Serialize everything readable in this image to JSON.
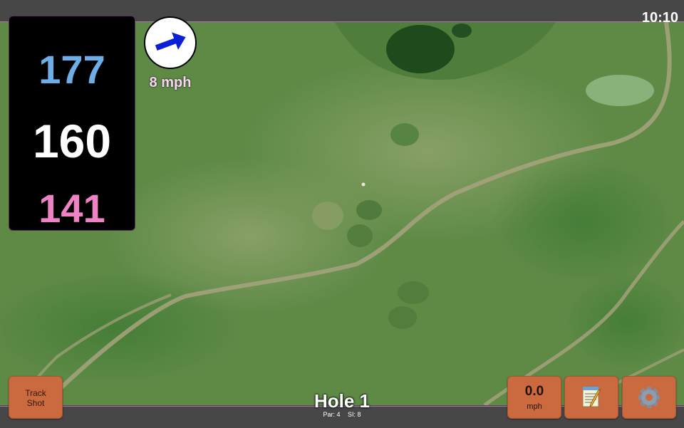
{
  "status_bar": {
    "time": "10:10"
  },
  "distances": {
    "back": "177",
    "middle": "160",
    "front": "141"
  },
  "wind": {
    "speed_label": "8 mph",
    "direction_icon": "arrow-east-northeast-icon",
    "arrow_color": "#0b1fd6"
  },
  "buttons": {
    "track_shot_label": "Track\nShot",
    "wind_speed_value": "0.0",
    "wind_speed_unit": "mph",
    "notes_icon": "notepad-icon",
    "settings_icon": "gear-icon"
  },
  "hole": {
    "title": "Hole 1",
    "par": "Par: 4",
    "stroke_index": "SI: 8"
  },
  "colors": {
    "back_distance": "#6eaee8",
    "middle_distance": "#ffffff",
    "front_distance": "#ee82c4",
    "button_bg": "#cc6a3f",
    "wind_label": "#fbd4f6"
  }
}
